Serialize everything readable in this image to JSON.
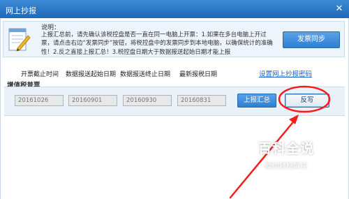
{
  "window": {
    "title": "网上抄报",
    "close_glyph": "✕"
  },
  "info": {
    "label": "说明：",
    "text": "上报汇总前，请先确认该税控盘是否一直在同一电脑上开票：1.如果在多台电脑上开过票，请点击右边“发票同步”按钮，将税控盘中的发票同步到本地电脑，以确保统计的准确性！2.反之直接上报汇总！3.税控盘日期大于数据报送起始日期才能上报",
    "sync_button": "发票同步"
  },
  "columns": {
    "h1": "开票截止时间",
    "h2": "数据报送起始日期",
    "h3": "数据报送终止日期",
    "h4": "最新报税日期"
  },
  "settings_link": "设置网上抄报密码",
  "section_title": "增值税普票",
  "row": {
    "v1": "20161026",
    "v2": "20160901",
    "v3": "20160930",
    "v4": "20160831",
    "summary_button": "上报汇总",
    "writeback_button": "反写"
  },
  "watermark": {
    "main": "百科全说",
    "sub": "助你轻松解决"
  },
  "colors": {
    "titlebar": "#2b78c8",
    "accent_button": "#3a8ad9",
    "annotation": "#ff1a1a",
    "link": "#1a62c4"
  }
}
